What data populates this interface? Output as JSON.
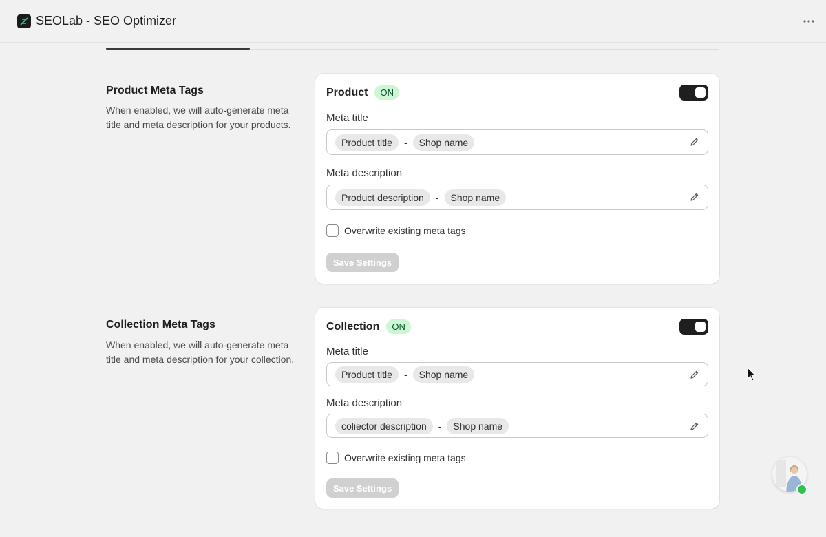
{
  "app": {
    "title": "SEOLab - SEO Optimizer",
    "logo_icon": "seolab-logo-icon",
    "menu_icon": "more-horizontal-icon"
  },
  "sections": [
    {
      "title": "Product Meta Tags",
      "description": "When enabled, we will auto-generate meta title and meta description for your products.",
      "card": {
        "title": "Product",
        "status": "ON",
        "toggle_on": true,
        "meta_title_label": "Meta title",
        "meta_title_chips": [
          "Product title",
          "Shop name"
        ],
        "separator": "-",
        "meta_description_label": "Meta description",
        "meta_description_chips": [
          "Product description",
          "Shop name"
        ],
        "overwrite_label": "Overwrite existing meta tags",
        "overwrite_checked": false,
        "save_label": "Save Settings"
      }
    },
    {
      "title": "Collection Meta Tags",
      "description": "When enabled, we will auto-generate meta title and meta description for your collection.",
      "card": {
        "title": "Collection",
        "status": "ON",
        "toggle_on": true,
        "meta_title_label": "Meta title",
        "meta_title_chips": [
          "Product title",
          "Shop name"
        ],
        "separator": "-",
        "meta_description_label": "Meta description",
        "meta_description_chips": [
          "coliector description",
          "Shop name"
        ],
        "overwrite_label": "Overwrite existing meta tags",
        "overwrite_checked": false,
        "save_label": "Save Settings"
      }
    }
  ],
  "colors": {
    "background": "#f1f1f1",
    "badge_bg": "#cdf7d3",
    "badge_text": "#0c5132",
    "toggle": "#1f1f1f",
    "online": "#2fc34a"
  }
}
